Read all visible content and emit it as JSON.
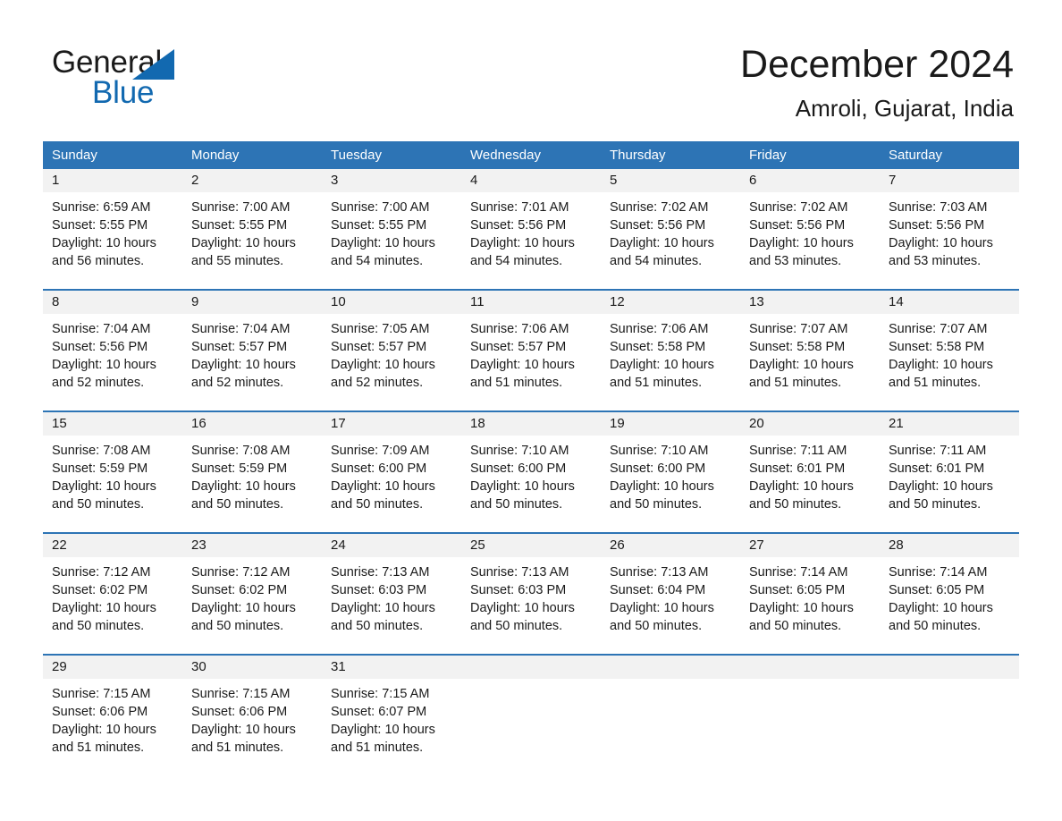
{
  "brand": {
    "word_one": "General",
    "word_two": "Blue",
    "triangle_icon": "brand-triangle-icon",
    "accent_color": "#1269b0"
  },
  "header": {
    "month_title": "December 2024",
    "location": "Amroli, Gujarat, India"
  },
  "theme": {
    "header_blue": "#2d74b5",
    "row_divider_blue": "#2d74b5",
    "daynum_band": "#f2f2f2",
    "text": "#1a1a1a"
  },
  "calendar": {
    "weekdays": [
      "Sunday",
      "Monday",
      "Tuesday",
      "Wednesday",
      "Thursday",
      "Friday",
      "Saturday"
    ],
    "weeks": [
      [
        {
          "day": "1",
          "sunrise": "Sunrise: 6:59 AM",
          "sunset": "Sunset: 5:55 PM",
          "daylight_1": "Daylight: 10 hours",
          "daylight_2": "and 56 minutes."
        },
        {
          "day": "2",
          "sunrise": "Sunrise: 7:00 AM",
          "sunset": "Sunset: 5:55 PM",
          "daylight_1": "Daylight: 10 hours",
          "daylight_2": "and 55 minutes."
        },
        {
          "day": "3",
          "sunrise": "Sunrise: 7:00 AM",
          "sunset": "Sunset: 5:55 PM",
          "daylight_1": "Daylight: 10 hours",
          "daylight_2": "and 54 minutes."
        },
        {
          "day": "4",
          "sunrise": "Sunrise: 7:01 AM",
          "sunset": "Sunset: 5:56 PM",
          "daylight_1": "Daylight: 10 hours",
          "daylight_2": "and 54 minutes."
        },
        {
          "day": "5",
          "sunrise": "Sunrise: 7:02 AM",
          "sunset": "Sunset: 5:56 PM",
          "daylight_1": "Daylight: 10 hours",
          "daylight_2": "and 54 minutes."
        },
        {
          "day": "6",
          "sunrise": "Sunrise: 7:02 AM",
          "sunset": "Sunset: 5:56 PM",
          "daylight_1": "Daylight: 10 hours",
          "daylight_2": "and 53 minutes."
        },
        {
          "day": "7",
          "sunrise": "Sunrise: 7:03 AM",
          "sunset": "Sunset: 5:56 PM",
          "daylight_1": "Daylight: 10 hours",
          "daylight_2": "and 53 minutes."
        }
      ],
      [
        {
          "day": "8",
          "sunrise": "Sunrise: 7:04 AM",
          "sunset": "Sunset: 5:56 PM",
          "daylight_1": "Daylight: 10 hours",
          "daylight_2": "and 52 minutes."
        },
        {
          "day": "9",
          "sunrise": "Sunrise: 7:04 AM",
          "sunset": "Sunset: 5:57 PM",
          "daylight_1": "Daylight: 10 hours",
          "daylight_2": "and 52 minutes."
        },
        {
          "day": "10",
          "sunrise": "Sunrise: 7:05 AM",
          "sunset": "Sunset: 5:57 PM",
          "daylight_1": "Daylight: 10 hours",
          "daylight_2": "and 52 minutes."
        },
        {
          "day": "11",
          "sunrise": "Sunrise: 7:06 AM",
          "sunset": "Sunset: 5:57 PM",
          "daylight_1": "Daylight: 10 hours",
          "daylight_2": "and 51 minutes."
        },
        {
          "day": "12",
          "sunrise": "Sunrise: 7:06 AM",
          "sunset": "Sunset: 5:58 PM",
          "daylight_1": "Daylight: 10 hours",
          "daylight_2": "and 51 minutes."
        },
        {
          "day": "13",
          "sunrise": "Sunrise: 7:07 AM",
          "sunset": "Sunset: 5:58 PM",
          "daylight_1": "Daylight: 10 hours",
          "daylight_2": "and 51 minutes."
        },
        {
          "day": "14",
          "sunrise": "Sunrise: 7:07 AM",
          "sunset": "Sunset: 5:58 PM",
          "daylight_1": "Daylight: 10 hours",
          "daylight_2": "and 51 minutes."
        }
      ],
      [
        {
          "day": "15",
          "sunrise": "Sunrise: 7:08 AM",
          "sunset": "Sunset: 5:59 PM",
          "daylight_1": "Daylight: 10 hours",
          "daylight_2": "and 50 minutes."
        },
        {
          "day": "16",
          "sunrise": "Sunrise: 7:08 AM",
          "sunset": "Sunset: 5:59 PM",
          "daylight_1": "Daylight: 10 hours",
          "daylight_2": "and 50 minutes."
        },
        {
          "day": "17",
          "sunrise": "Sunrise: 7:09 AM",
          "sunset": "Sunset: 6:00 PM",
          "daylight_1": "Daylight: 10 hours",
          "daylight_2": "and 50 minutes."
        },
        {
          "day": "18",
          "sunrise": "Sunrise: 7:10 AM",
          "sunset": "Sunset: 6:00 PM",
          "daylight_1": "Daylight: 10 hours",
          "daylight_2": "and 50 minutes."
        },
        {
          "day": "19",
          "sunrise": "Sunrise: 7:10 AM",
          "sunset": "Sunset: 6:00 PM",
          "daylight_1": "Daylight: 10 hours",
          "daylight_2": "and 50 minutes."
        },
        {
          "day": "20",
          "sunrise": "Sunrise: 7:11 AM",
          "sunset": "Sunset: 6:01 PM",
          "daylight_1": "Daylight: 10 hours",
          "daylight_2": "and 50 minutes."
        },
        {
          "day": "21",
          "sunrise": "Sunrise: 7:11 AM",
          "sunset": "Sunset: 6:01 PM",
          "daylight_1": "Daylight: 10 hours",
          "daylight_2": "and 50 minutes."
        }
      ],
      [
        {
          "day": "22",
          "sunrise": "Sunrise: 7:12 AM",
          "sunset": "Sunset: 6:02 PM",
          "daylight_1": "Daylight: 10 hours",
          "daylight_2": "and 50 minutes."
        },
        {
          "day": "23",
          "sunrise": "Sunrise: 7:12 AM",
          "sunset": "Sunset: 6:02 PM",
          "daylight_1": "Daylight: 10 hours",
          "daylight_2": "and 50 minutes."
        },
        {
          "day": "24",
          "sunrise": "Sunrise: 7:13 AM",
          "sunset": "Sunset: 6:03 PM",
          "daylight_1": "Daylight: 10 hours",
          "daylight_2": "and 50 minutes."
        },
        {
          "day": "25",
          "sunrise": "Sunrise: 7:13 AM",
          "sunset": "Sunset: 6:03 PM",
          "daylight_1": "Daylight: 10 hours",
          "daylight_2": "and 50 minutes."
        },
        {
          "day": "26",
          "sunrise": "Sunrise: 7:13 AM",
          "sunset": "Sunset: 6:04 PM",
          "daylight_1": "Daylight: 10 hours",
          "daylight_2": "and 50 minutes."
        },
        {
          "day": "27",
          "sunrise": "Sunrise: 7:14 AM",
          "sunset": "Sunset: 6:05 PM",
          "daylight_1": "Daylight: 10 hours",
          "daylight_2": "and 50 minutes."
        },
        {
          "day": "28",
          "sunrise": "Sunrise: 7:14 AM",
          "sunset": "Sunset: 6:05 PM",
          "daylight_1": "Daylight: 10 hours",
          "daylight_2": "and 50 minutes."
        }
      ],
      [
        {
          "day": "29",
          "sunrise": "Sunrise: 7:15 AM",
          "sunset": "Sunset: 6:06 PM",
          "daylight_1": "Daylight: 10 hours",
          "daylight_2": "and 51 minutes."
        },
        {
          "day": "30",
          "sunrise": "Sunrise: 7:15 AM",
          "sunset": "Sunset: 6:06 PM",
          "daylight_1": "Daylight: 10 hours",
          "daylight_2": "and 51 minutes."
        },
        {
          "day": "31",
          "sunrise": "Sunrise: 7:15 AM",
          "sunset": "Sunset: 6:07 PM",
          "daylight_1": "Daylight: 10 hours",
          "daylight_2": "and 51 minutes."
        },
        {
          "day": "",
          "sunrise": "",
          "sunset": "",
          "daylight_1": "",
          "daylight_2": ""
        },
        {
          "day": "",
          "sunrise": "",
          "sunset": "",
          "daylight_1": "",
          "daylight_2": ""
        },
        {
          "day": "",
          "sunrise": "",
          "sunset": "",
          "daylight_1": "",
          "daylight_2": ""
        },
        {
          "day": "",
          "sunrise": "",
          "sunset": "",
          "daylight_1": "",
          "daylight_2": ""
        }
      ]
    ]
  }
}
